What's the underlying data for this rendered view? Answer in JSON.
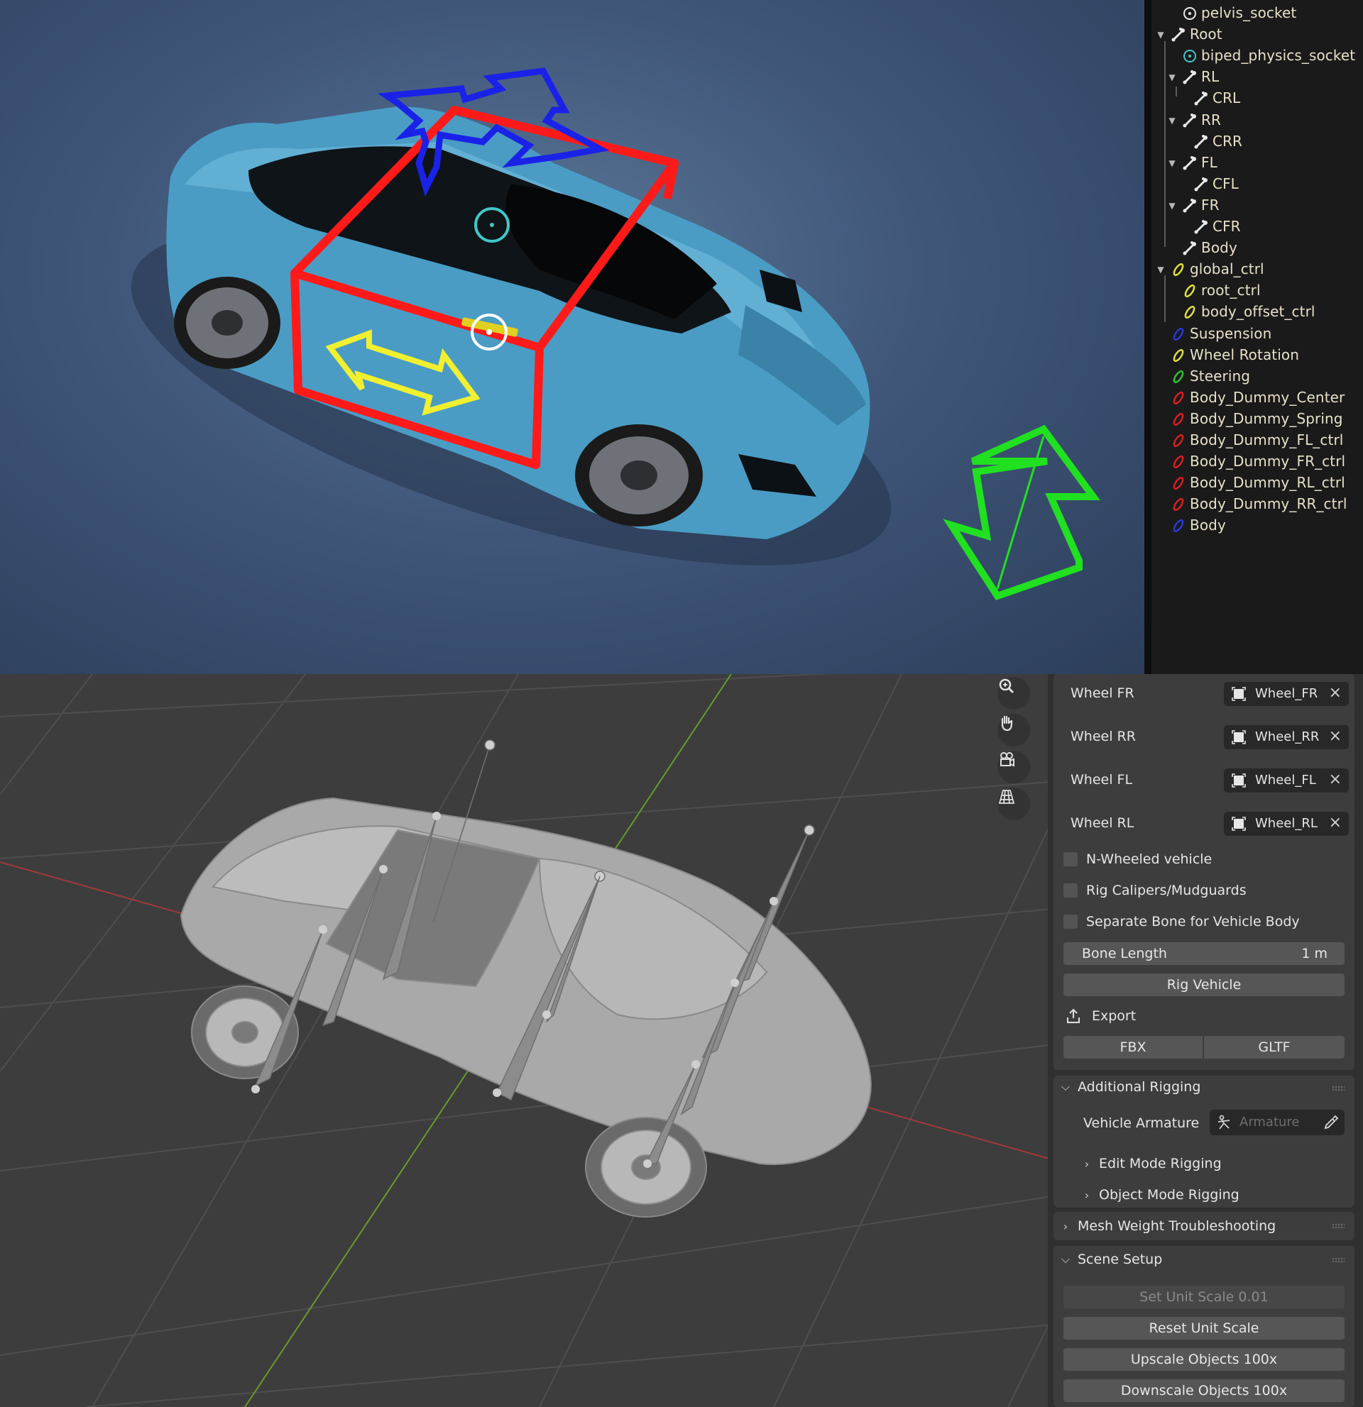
{
  "outliner": {
    "items": [
      {
        "label": "pelvis_socket",
        "type": "socket"
      },
      {
        "label": "Root",
        "type": "bone"
      },
      {
        "label": "biped_physics_socket",
        "type": "socket-cyan"
      },
      {
        "label": "RL",
        "type": "bone"
      },
      {
        "label": "CRL",
        "type": "bone"
      },
      {
        "label": "RR",
        "type": "bone"
      },
      {
        "label": "CRR",
        "type": "bone"
      },
      {
        "label": "FL",
        "type": "bone"
      },
      {
        "label": "CFL",
        "type": "bone"
      },
      {
        "label": "FR",
        "type": "bone"
      },
      {
        "label": "CFR",
        "type": "bone"
      },
      {
        "label": "Body",
        "type": "bone"
      },
      {
        "label": "global_ctrl",
        "type": "ctrl",
        "color": "#e0e040"
      },
      {
        "label": "root_ctrl",
        "type": "ctrl",
        "color": "#e0e040"
      },
      {
        "label": "body_offset_ctrl",
        "type": "ctrl",
        "color": "#e0e040"
      },
      {
        "label": "Suspension",
        "type": "ctrl",
        "color": "#2a3ad8"
      },
      {
        "label": "Wheel Rotation",
        "type": "ctrl",
        "color": "#e0e040"
      },
      {
        "label": "Steering",
        "type": "ctrl",
        "color": "#30c030"
      },
      {
        "label": "Body_Dummy_Center",
        "type": "ctrl",
        "color": "#d82020"
      },
      {
        "label": "Body_Dummy_Spring",
        "type": "ctrl",
        "color": "#d82020"
      },
      {
        "label": "Body_Dummy_FL_ctrl",
        "type": "ctrl",
        "color": "#d82020"
      },
      {
        "label": "Body_Dummy_FR_ctrl",
        "type": "ctrl",
        "color": "#d82020"
      },
      {
        "label": "Body_Dummy_RL_ctrl",
        "type": "ctrl",
        "color": "#d82020"
      },
      {
        "label": "Body_Dummy_RR_ctrl",
        "type": "ctrl",
        "color": "#d82020"
      },
      {
        "label": "Body",
        "type": "ctrl",
        "color": "#2a3ad8"
      }
    ]
  },
  "nav_icons": [
    "zoom-icon",
    "hand-pan-icon",
    "camera-icon",
    "grid-perspective-icon"
  ],
  "wheels": [
    {
      "label": "Wheel FR",
      "object": "Wheel_FR"
    },
    {
      "label": "Wheel RR",
      "object": "Wheel_RR"
    },
    {
      "label": "Wheel FL",
      "object": "Wheel_FL"
    },
    {
      "label": "Wheel RL",
      "object": "Wheel_RL"
    }
  ],
  "options": {
    "n_wheeled": "N-Wheeled vehicle",
    "rig_calipers": "Rig Calipers/Mudguards",
    "separate_bone": "Separate Bone for Vehicle Body"
  },
  "bone_length": {
    "label": "Bone Length",
    "value": "1 m"
  },
  "rig_vehicle": "Rig Vehicle",
  "export": {
    "label": "Export",
    "fbx": "FBX",
    "gltf": "GLTF"
  },
  "additional_rigging": {
    "title": "Additional Rigging",
    "armature_label": "Vehicle Armature",
    "armature_placeholder": "Armature",
    "edit_mode": "Edit Mode Rigging",
    "object_mode": "Object Mode Rigging"
  },
  "mesh_weight": {
    "title": "Mesh Weight Troubleshooting"
  },
  "scene_setup": {
    "title": "Scene Setup",
    "set_unit_scale": "Set Unit Scale 0.01",
    "reset_unit_scale": "Reset Unit Scale",
    "upscale": "Upscale Objects 100x",
    "downscale": "Downscale Objects 100x"
  },
  "colors": {
    "red_gizmo": "#ff1a1a",
    "blue_gizmo": "#1a22e8",
    "yellow_gizmo": "#f0f030",
    "green_gizmo": "#20e020",
    "car_paint": "#4aa0c8"
  }
}
